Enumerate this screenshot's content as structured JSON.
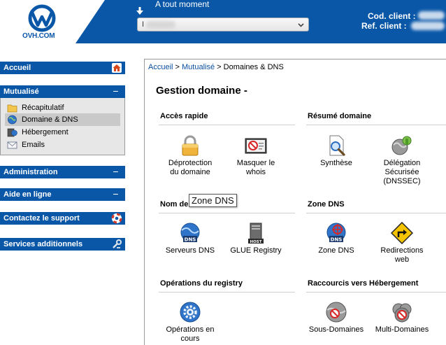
{
  "header": {
    "logo_text": "OVH.COM",
    "moment_label": "A tout moment",
    "select_value": "I",
    "client_code_label": "Cod. client :",
    "client_ref_label": "Ref. client :",
    "brand_color": "#0a57a8"
  },
  "sidebar": {
    "accueil": "Accueil",
    "mutualise": {
      "title": "Mutualisé",
      "items": [
        {
          "label": "Récapitulatif",
          "icon": "folder-icon"
        },
        {
          "label": "Domaine & DNS",
          "icon": "globe-icon",
          "active": true
        },
        {
          "label": "Hébergement",
          "icon": "server-globe-icon"
        },
        {
          "label": "Emails",
          "icon": "envelope-icon"
        }
      ]
    },
    "administration": "Administration",
    "aide": "Aide en ligne",
    "support": "Contactez le support",
    "services": "Services additionnels"
  },
  "main": {
    "breadcrumb": {
      "accueil": "Accueil",
      "sep1": " > ",
      "mutualise": "Mutualisé",
      "rest": " > Domaines & DNS"
    },
    "title": "Gestion domaine -",
    "sections": {
      "acces_rapide": "Accès rapide",
      "resume_domaine": "Résumé domaine",
      "nom_domaine": "Nom de domaine",
      "zone_dns": "Zone DNS",
      "operations_registry": "Opérations du registry",
      "raccourcis": "Raccourcis vers Hébergement"
    },
    "tiles": {
      "deprotection": "Déprotection\ndu domaine",
      "masquer_whois": "Masquer le\nwhois",
      "synthese": "Synthèse",
      "delegation": "Délégation\nSécurisée\n(DNSSEC)",
      "serveurs_dns": "Serveurs DNS",
      "glue": "GLUE Registry",
      "zone_dns": "Zone DNS",
      "redirections": "Redirections\nweb",
      "operations": "Opérations en\ncours",
      "sous_domaines": "Sous-Domaines",
      "multi_domaines": "Multi-Domaines"
    },
    "tooltip": "Zone DNS"
  }
}
